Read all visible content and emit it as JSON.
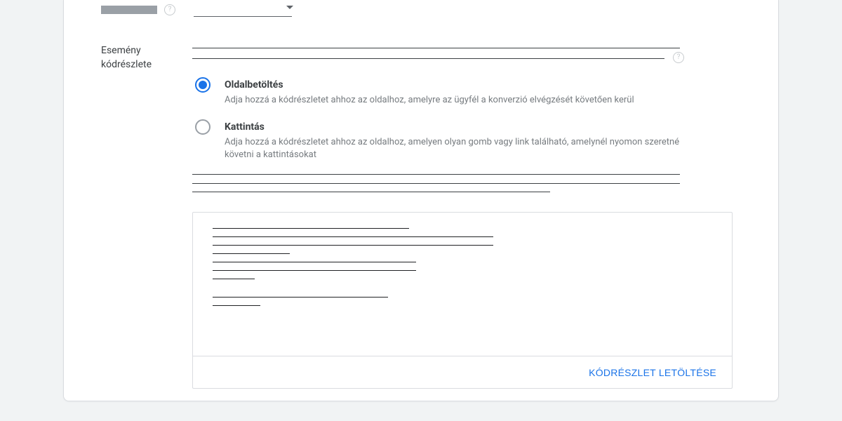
{
  "section_label": "Esemény kódrészlete",
  "options": [
    {
      "title": "Oldalbetöltés",
      "desc": "Adja hozzá a kódrészletet ahhoz az oldalhoz, amelyre az ügyfél a konverzió elvégzését követően kerül",
      "selected": true
    },
    {
      "title": "Kattintás",
      "desc": "Adja hozzá a kódrészletet ahhoz az oldalhoz, amelyen olyan gomb vagy link található, amelynél nyomon szeretné követni a kattintásokat",
      "selected": false
    }
  ],
  "download_label": "KÓDRÉSZLET LETÖLTÉSE",
  "help_glyph": "?"
}
